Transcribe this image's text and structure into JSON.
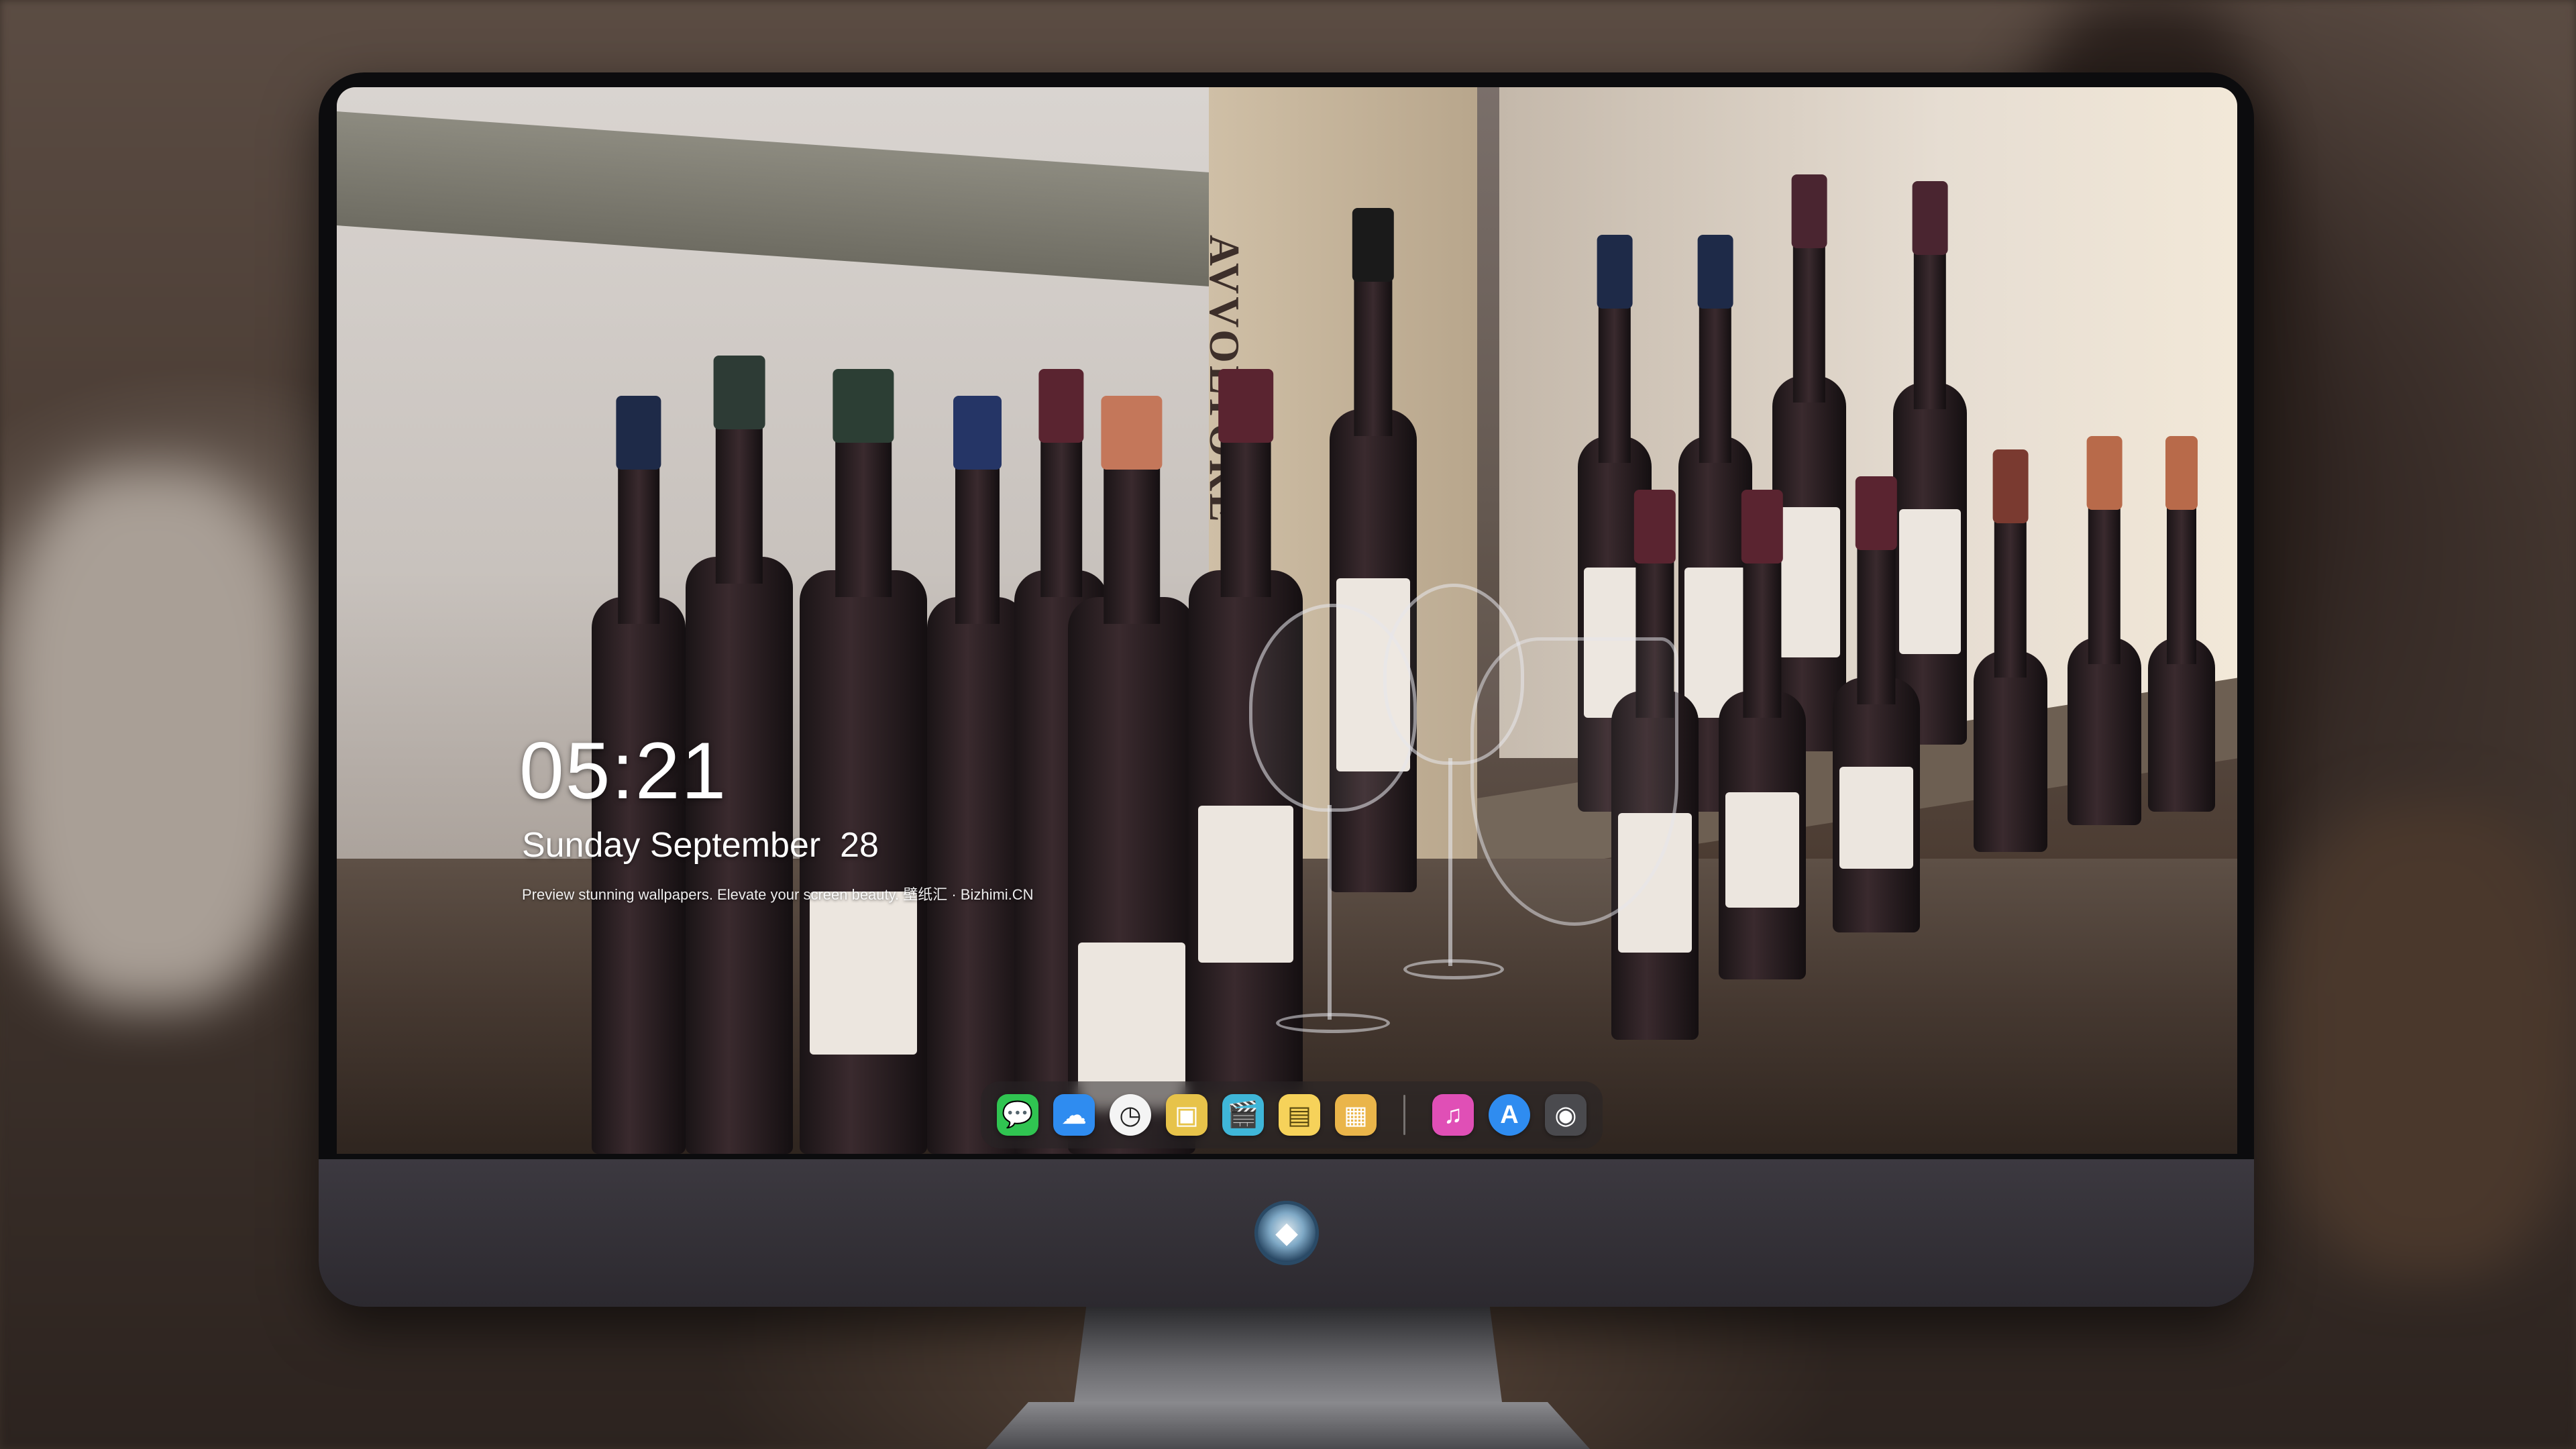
{
  "lock_screen": {
    "time": "05:21",
    "day": "Sunday",
    "month": "September",
    "date": "28",
    "tagline": "Preview stunning wallpapers. Elevate your screen beauty. 壁纸汇 · Bizhimi.CN"
  },
  "wallpaper": {
    "crate_text": "AVVOLTORE"
  },
  "dock": {
    "apps": [
      {
        "name": "messages-icon",
        "glyph": "💬",
        "color": "#30c451"
      },
      {
        "name": "weather-icon",
        "glyph": "☁",
        "color": "#2f8cf0"
      },
      {
        "name": "clock-icon",
        "glyph": "◷",
        "color": "#f4f4f4"
      },
      {
        "name": "preview-icon",
        "glyph": "▣",
        "color": "#e7c34a"
      },
      {
        "name": "clips-icon",
        "glyph": "🎬",
        "color": "#3fb6d8"
      },
      {
        "name": "notes-icon",
        "glyph": "▤",
        "color": "#f6d25a"
      },
      {
        "name": "photos-icon",
        "glyph": "▦",
        "color": "#eab54a"
      }
    ],
    "pinned": [
      {
        "name": "music-icon",
        "glyph": "♫",
        "color": "#e04fb6"
      },
      {
        "name": "app-store-icon",
        "glyph": "A",
        "color": "#2f8cf0"
      },
      {
        "name": "camera-icon",
        "glyph": "◉",
        "color": "#4a4a4e"
      }
    ]
  },
  "monitor": {
    "logo_name": "brand-logo-icon"
  }
}
